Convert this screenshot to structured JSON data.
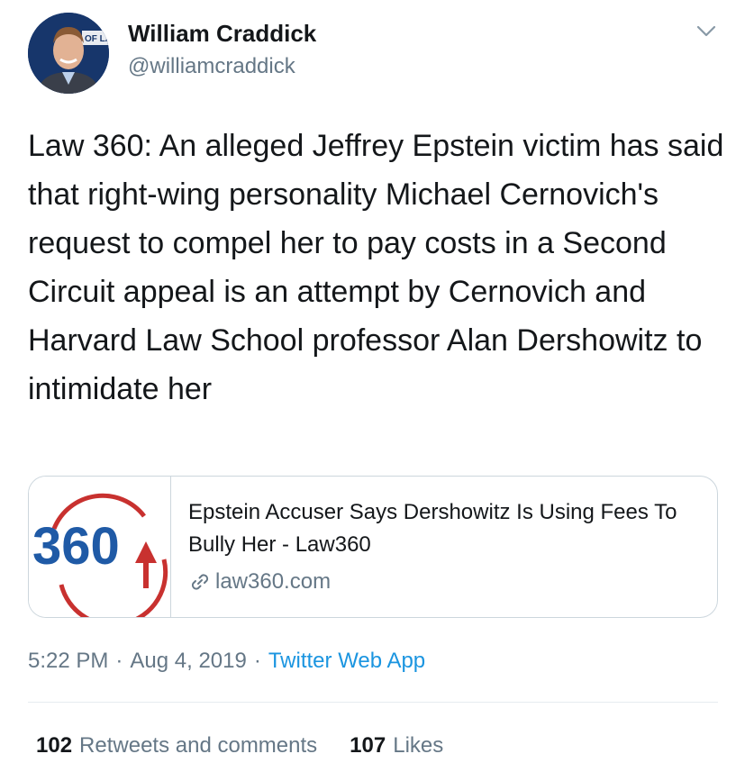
{
  "author": {
    "name": "William Craddick",
    "handle": "@williamcraddick",
    "avatar_banner_text": "OF LA"
  },
  "tweet": {
    "text": "Law 360: An alleged Jeffrey Epstein victim has said that right-wing personality Michael Cernovich's request to compel her to pay costs in a Second Circuit appeal is an attempt by Cernovich and Harvard Law School professor Alan Dershowitz to intimidate her"
  },
  "card": {
    "logo_text": "360",
    "title": "Epstein Accuser Says Dershowitz Is Using Fees To Bully Her - Law360",
    "domain": "law360.com"
  },
  "meta": {
    "time": "5:22 PM",
    "separator": "·",
    "date": "Aug 4, 2019",
    "source": "Twitter Web App"
  },
  "stats": {
    "retweets_count": "102",
    "retweets_label": "Retweets and comments",
    "likes_count": "107",
    "likes_label": "Likes"
  },
  "icons": {
    "menu": "chevron-down-icon",
    "link": "link-icon"
  },
  "colors": {
    "text": "#14171a",
    "secondary": "#657786",
    "link": "#1b95e0",
    "border": "#ccd6dd",
    "logo_blue": "#1f5aa6",
    "logo_red": "#c8312f"
  }
}
